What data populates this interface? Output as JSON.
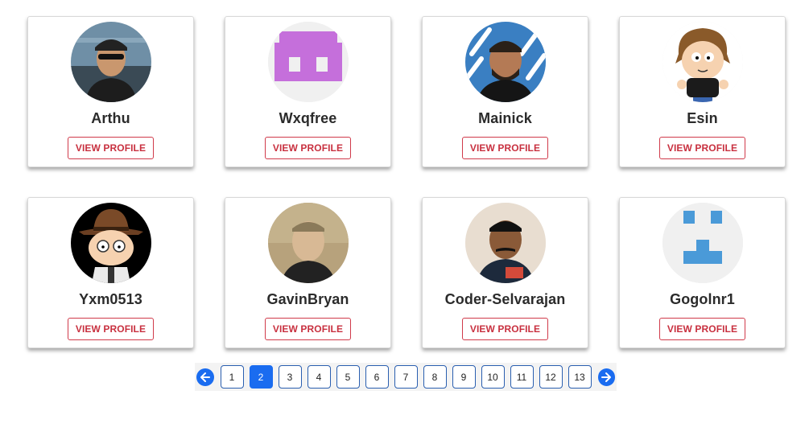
{
  "profiles": [
    {
      "name": "Arthu",
      "button": "VIEW PROFILE",
      "avatar": "photo-man-sunglasses-cap"
    },
    {
      "name": "Wxqfree",
      "button": "VIEW PROFILE",
      "avatar": "identicon-purple"
    },
    {
      "name": "Mainick",
      "button": "VIEW PROFILE",
      "avatar": "photo-man-beard"
    },
    {
      "name": "Esin",
      "button": "VIEW PROFILE",
      "avatar": "cartoon-curly-hair"
    },
    {
      "name": "Yxm0513",
      "button": "VIEW PROFILE",
      "avatar": "cartoon-hat-glasses"
    },
    {
      "name": "GavinBryan",
      "button": "VIEW PROFILE",
      "avatar": "photo-man-sepia"
    },
    {
      "name": "Coder-Selvarajan",
      "button": "VIEW PROFILE",
      "avatar": "photo-man-mustache"
    },
    {
      "name": "Gogolnr1",
      "button": "VIEW PROFILE",
      "avatar": "identicon-blue"
    }
  ],
  "pagination": {
    "prev_icon": "arrow-left-icon",
    "next_icon": "arrow-right-icon",
    "pages": [
      "1",
      "2",
      "3",
      "4",
      "5",
      "6",
      "7",
      "8",
      "9",
      "10",
      "11",
      "12",
      "13"
    ],
    "current": "2"
  },
  "colors": {
    "accent": "#1a6cf0",
    "button_border": "#d03a4a",
    "button_text": "#c8303f",
    "identicon_purple": "#c56fdb",
    "identicon_blue": "#4a9ad8"
  }
}
